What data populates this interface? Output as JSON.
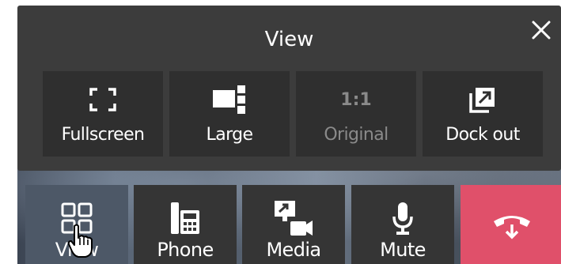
{
  "panel": {
    "title": "View",
    "close_icon": "close-icon",
    "options": [
      {
        "label": "Fullscreen",
        "icon": "fullscreen-icon",
        "enabled": true
      },
      {
        "label": "Large",
        "icon": "large-layout-icon",
        "enabled": true
      },
      {
        "label": "Original",
        "icon_text": "1:1",
        "enabled": false
      },
      {
        "label": "Dock out",
        "icon": "dock-out-icon",
        "enabled": true
      }
    ]
  },
  "toolbar": {
    "buttons": [
      {
        "label": "View",
        "icon": "grid-icon",
        "active": true
      },
      {
        "label": "Phone",
        "icon": "desk-phone-icon"
      },
      {
        "label": "Media",
        "icon": "media-share-icon"
      },
      {
        "label": "Mute",
        "icon": "microphone-icon"
      },
      {
        "label": "",
        "icon": "hang-up-icon",
        "color": "#e0506a"
      }
    ]
  },
  "colors": {
    "panel": "#3c3c3c",
    "tile": "#2f2f2f",
    "hangup": "#e0506a",
    "active": "#4d5867"
  }
}
